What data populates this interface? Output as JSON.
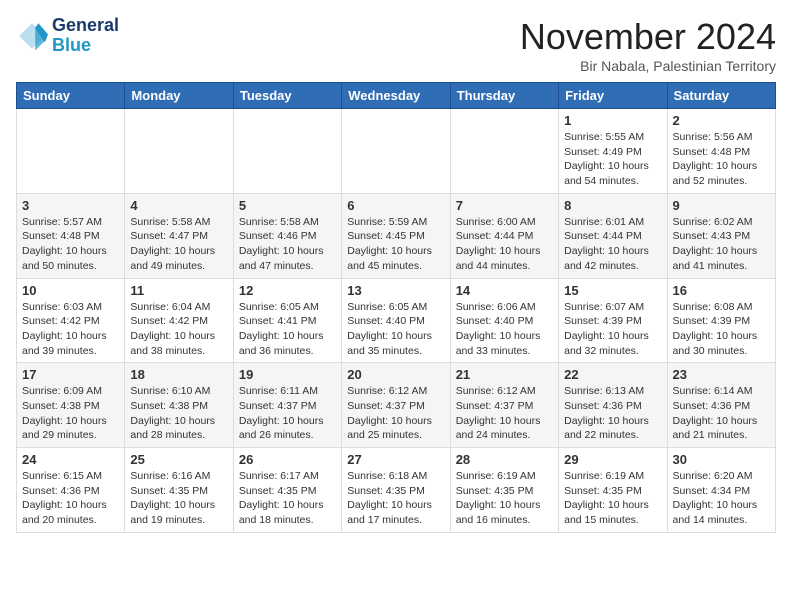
{
  "header": {
    "logo_line1": "General",
    "logo_line2": "Blue",
    "month_title": "November 2024",
    "location": "Bir Nabala, Palestinian Territory"
  },
  "weekdays": [
    "Sunday",
    "Monday",
    "Tuesday",
    "Wednesday",
    "Thursday",
    "Friday",
    "Saturday"
  ],
  "weeks": [
    [
      {
        "day": "",
        "info": ""
      },
      {
        "day": "",
        "info": ""
      },
      {
        "day": "",
        "info": ""
      },
      {
        "day": "",
        "info": ""
      },
      {
        "day": "",
        "info": ""
      },
      {
        "day": "1",
        "info": "Sunrise: 5:55 AM\nSunset: 4:49 PM\nDaylight: 10 hours and 54 minutes."
      },
      {
        "day": "2",
        "info": "Sunrise: 5:56 AM\nSunset: 4:48 PM\nDaylight: 10 hours and 52 minutes."
      }
    ],
    [
      {
        "day": "3",
        "info": "Sunrise: 5:57 AM\nSunset: 4:48 PM\nDaylight: 10 hours and 50 minutes."
      },
      {
        "day": "4",
        "info": "Sunrise: 5:58 AM\nSunset: 4:47 PM\nDaylight: 10 hours and 49 minutes."
      },
      {
        "day": "5",
        "info": "Sunrise: 5:58 AM\nSunset: 4:46 PM\nDaylight: 10 hours and 47 minutes."
      },
      {
        "day": "6",
        "info": "Sunrise: 5:59 AM\nSunset: 4:45 PM\nDaylight: 10 hours and 45 minutes."
      },
      {
        "day": "7",
        "info": "Sunrise: 6:00 AM\nSunset: 4:44 PM\nDaylight: 10 hours and 44 minutes."
      },
      {
        "day": "8",
        "info": "Sunrise: 6:01 AM\nSunset: 4:44 PM\nDaylight: 10 hours and 42 minutes."
      },
      {
        "day": "9",
        "info": "Sunrise: 6:02 AM\nSunset: 4:43 PM\nDaylight: 10 hours and 41 minutes."
      }
    ],
    [
      {
        "day": "10",
        "info": "Sunrise: 6:03 AM\nSunset: 4:42 PM\nDaylight: 10 hours and 39 minutes."
      },
      {
        "day": "11",
        "info": "Sunrise: 6:04 AM\nSunset: 4:42 PM\nDaylight: 10 hours and 38 minutes."
      },
      {
        "day": "12",
        "info": "Sunrise: 6:05 AM\nSunset: 4:41 PM\nDaylight: 10 hours and 36 minutes."
      },
      {
        "day": "13",
        "info": "Sunrise: 6:05 AM\nSunset: 4:40 PM\nDaylight: 10 hours and 35 minutes."
      },
      {
        "day": "14",
        "info": "Sunrise: 6:06 AM\nSunset: 4:40 PM\nDaylight: 10 hours and 33 minutes."
      },
      {
        "day": "15",
        "info": "Sunrise: 6:07 AM\nSunset: 4:39 PM\nDaylight: 10 hours and 32 minutes."
      },
      {
        "day": "16",
        "info": "Sunrise: 6:08 AM\nSunset: 4:39 PM\nDaylight: 10 hours and 30 minutes."
      }
    ],
    [
      {
        "day": "17",
        "info": "Sunrise: 6:09 AM\nSunset: 4:38 PM\nDaylight: 10 hours and 29 minutes."
      },
      {
        "day": "18",
        "info": "Sunrise: 6:10 AM\nSunset: 4:38 PM\nDaylight: 10 hours and 28 minutes."
      },
      {
        "day": "19",
        "info": "Sunrise: 6:11 AM\nSunset: 4:37 PM\nDaylight: 10 hours and 26 minutes."
      },
      {
        "day": "20",
        "info": "Sunrise: 6:12 AM\nSunset: 4:37 PM\nDaylight: 10 hours and 25 minutes."
      },
      {
        "day": "21",
        "info": "Sunrise: 6:12 AM\nSunset: 4:37 PM\nDaylight: 10 hours and 24 minutes."
      },
      {
        "day": "22",
        "info": "Sunrise: 6:13 AM\nSunset: 4:36 PM\nDaylight: 10 hours and 22 minutes."
      },
      {
        "day": "23",
        "info": "Sunrise: 6:14 AM\nSunset: 4:36 PM\nDaylight: 10 hours and 21 minutes."
      }
    ],
    [
      {
        "day": "24",
        "info": "Sunrise: 6:15 AM\nSunset: 4:36 PM\nDaylight: 10 hours and 20 minutes."
      },
      {
        "day": "25",
        "info": "Sunrise: 6:16 AM\nSunset: 4:35 PM\nDaylight: 10 hours and 19 minutes."
      },
      {
        "day": "26",
        "info": "Sunrise: 6:17 AM\nSunset: 4:35 PM\nDaylight: 10 hours and 18 minutes."
      },
      {
        "day": "27",
        "info": "Sunrise: 6:18 AM\nSunset: 4:35 PM\nDaylight: 10 hours and 17 minutes."
      },
      {
        "day": "28",
        "info": "Sunrise: 6:19 AM\nSunset: 4:35 PM\nDaylight: 10 hours and 16 minutes."
      },
      {
        "day": "29",
        "info": "Sunrise: 6:19 AM\nSunset: 4:35 PM\nDaylight: 10 hours and 15 minutes."
      },
      {
        "day": "30",
        "info": "Sunrise: 6:20 AM\nSunset: 4:34 PM\nDaylight: 10 hours and 14 minutes."
      }
    ]
  ]
}
